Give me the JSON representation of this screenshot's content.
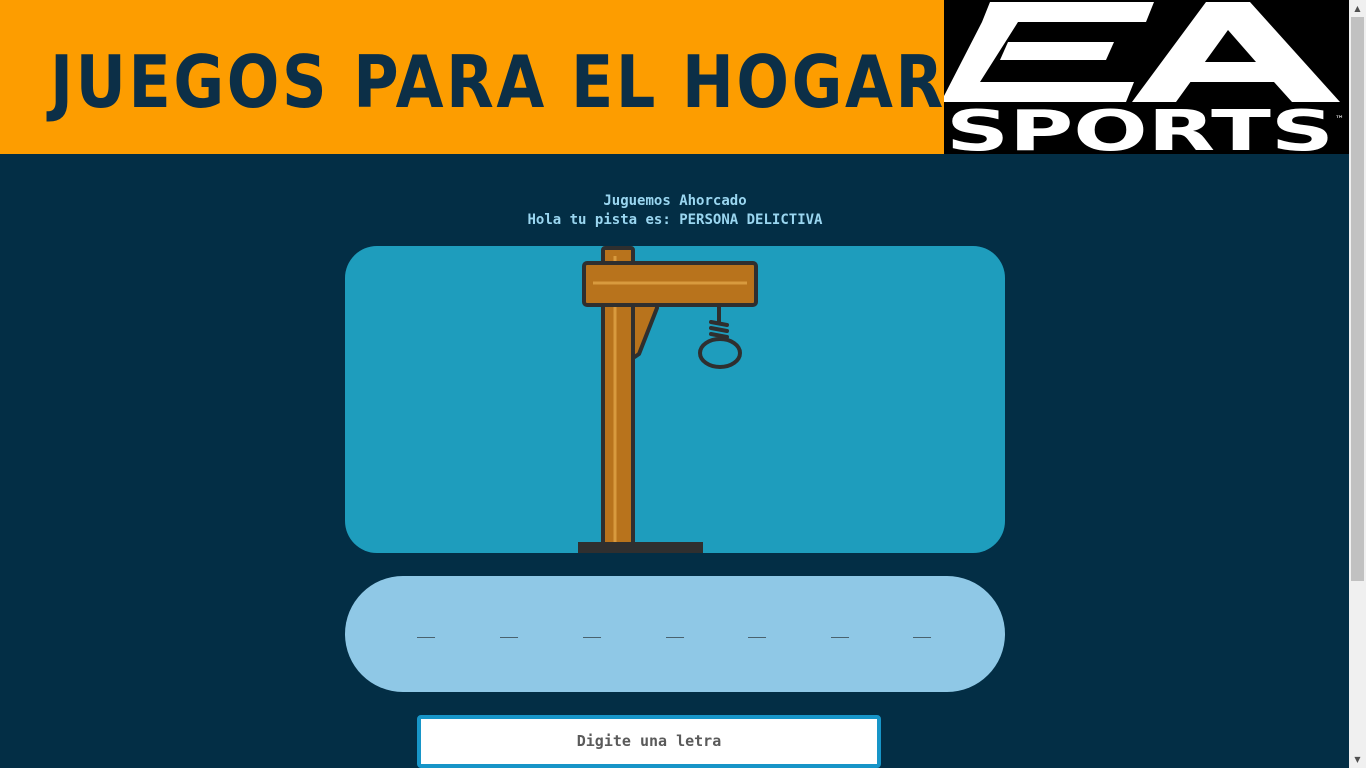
{
  "header": {
    "title": "JUEGOS PARA EL HOGAR",
    "logo": {
      "name": "ea-sports-logo",
      "text": "SPORTS",
      "trademark": "™"
    }
  },
  "game": {
    "heading": "Juguemos Ahorcado",
    "hint": "Hola tu pista es: PERSONA DELICTIVA",
    "gallows_icon": "gallows-icon",
    "word_slots": [
      "__",
      "__",
      "__",
      "__",
      "__",
      "__",
      "__"
    ],
    "input": {
      "placeholder": "Digite una letra",
      "value": ""
    }
  },
  "colors": {
    "banner": "#fd9d00",
    "background": "#032e45",
    "gallows_panel": "#1e9dbd",
    "word_panel": "#8fc8e6",
    "title": "#0c2f47",
    "text": "#9ad6f0"
  }
}
